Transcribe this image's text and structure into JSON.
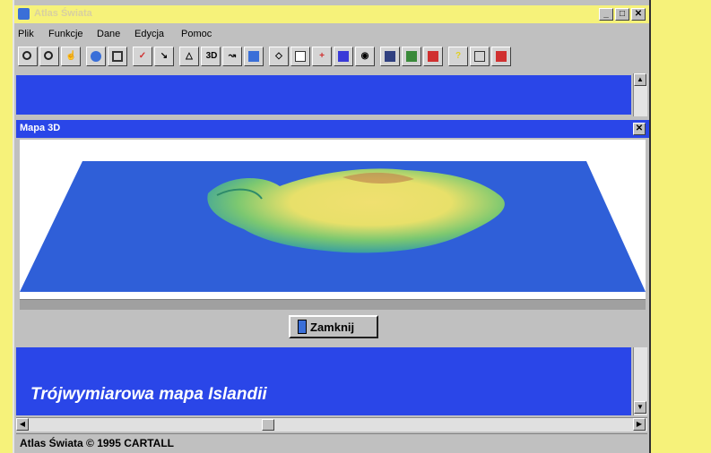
{
  "window": {
    "title": "Atlas Świata",
    "minimize_label": "_",
    "maximize_label": "□",
    "close_label": "✕"
  },
  "menu": {
    "items": [
      "Plik",
      "Funkcje",
      "Dane",
      "Edycja",
      "Pomoc"
    ]
  },
  "toolbar": {
    "tools": [
      "zoom-in",
      "zoom-out",
      "hand",
      "globe",
      "layers",
      "check",
      "path",
      "bell",
      "3D",
      "graph",
      "chart",
      "tag",
      "page",
      "add",
      "save",
      "camera",
      "city",
      "map",
      "flag",
      "help",
      "print",
      "exit"
    ],
    "label_3d": "3D"
  },
  "child_window": {
    "title": "Mapa 3D",
    "close_label": "✕",
    "close_button_label": "Zamknij"
  },
  "caption": "Trójwymiarowa mapa Islandii",
  "status": "Atlas Świata © 1995 CARTALL",
  "colors": {
    "accent_blue": "#2a46e8",
    "background_yellow": "#f6f27a"
  }
}
